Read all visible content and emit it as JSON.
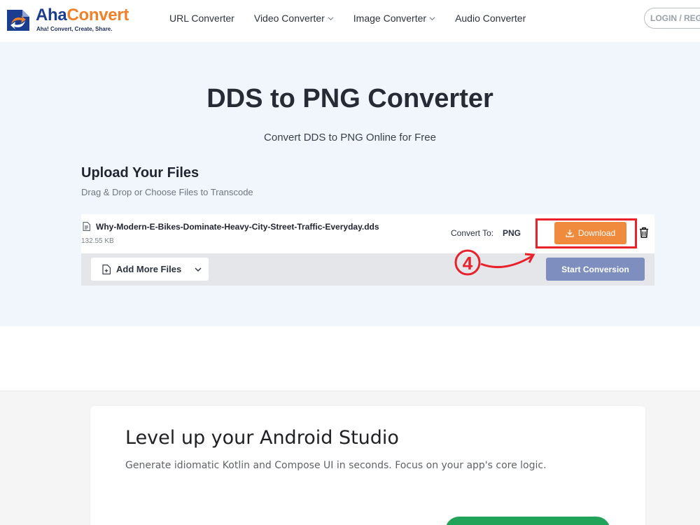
{
  "brand": {
    "name_part1": "Aha",
    "name_part2": "Convert",
    "tagline": "Aha! Convert, Create, Share.",
    "colors": {
      "primary": "#1b3d8f",
      "accent": "#f0812b"
    }
  },
  "nav": {
    "items": [
      {
        "label": "URL Converter",
        "has_dropdown": false
      },
      {
        "label": "Video Converter",
        "has_dropdown": true
      },
      {
        "label": "Image Converter",
        "has_dropdown": true
      },
      {
        "label": "Audio Converter",
        "has_dropdown": false
      }
    ],
    "login_label": "LOGIN / REG"
  },
  "hero": {
    "title": "DDS to PNG Converter",
    "subtitle": "Convert DDS to PNG Online for Free"
  },
  "upload": {
    "title": "Upload Your Files",
    "subtitle": "Drag & Drop or Choose Files to Transcode",
    "file": {
      "name": "Why-Modern-E-Bikes-Dominate-Heavy-City-Street-Traffic-Everyday.dds",
      "size": "132.55 KB",
      "convert_to_label": "Convert To:",
      "format": "PNG",
      "download_label": "Download",
      "file_icon": "document-icon",
      "delete_icon": "trash-icon"
    },
    "add_more_label": "Add More Files",
    "start_conversion_label": "Start Conversion"
  },
  "annotation": {
    "step": "4",
    "color": "#e8212b"
  },
  "ad": {
    "title": "Level up your Android Studio",
    "subtitle": "Generate idiomatic Kotlin and Compose UI in seconds. Focus on your app's core logic.",
    "cta_color": "#22a35a"
  }
}
